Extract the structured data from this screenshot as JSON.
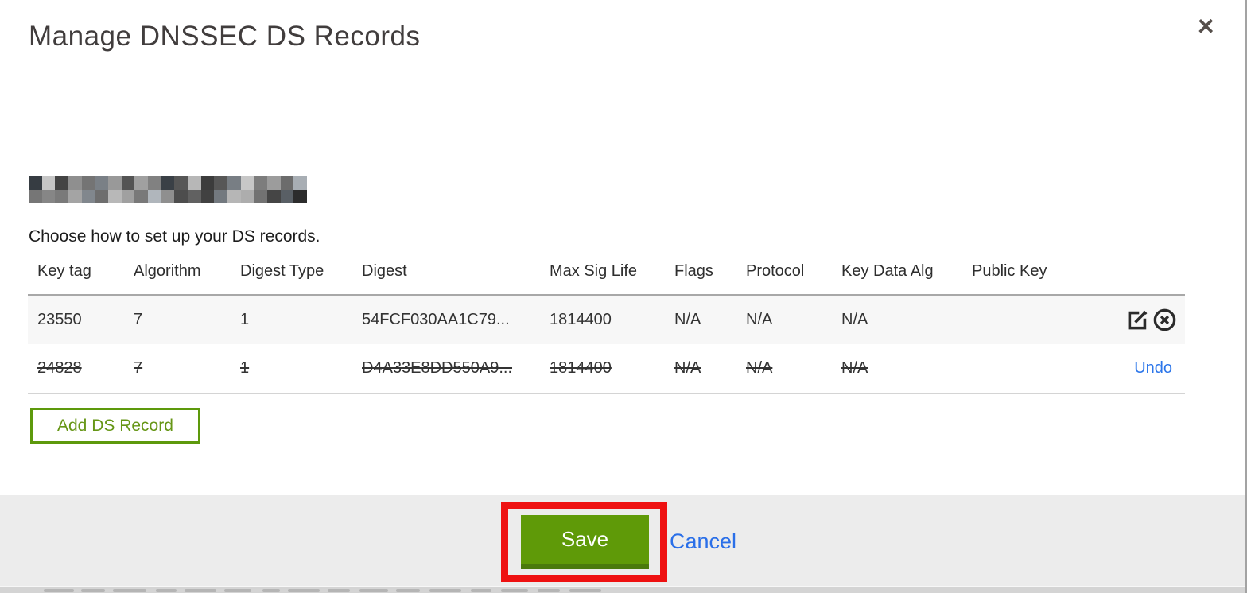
{
  "modal": {
    "title": "Manage DNSSEC DS Records",
    "close_glyph": "✕",
    "instruction": "Choose how to set up your DS records.",
    "add_button_label": "Add DS Record",
    "domain_redacted": true
  },
  "table": {
    "columns": [
      "Key tag",
      "Algorithm",
      "Digest Type",
      "Digest",
      "Max Sig Life",
      "Flags",
      "Protocol",
      "Key Data Alg",
      "Public Key"
    ],
    "rows": [
      {
        "key_tag": "23550",
        "algorithm": "7",
        "digest_type": "1",
        "digest": "54FCF030AA1C79...",
        "max_sig_life": "1814400",
        "flags": "N/A",
        "protocol": "N/A",
        "key_data_alg": "N/A",
        "public_key": "",
        "state": "normal",
        "actions": [
          "edit",
          "delete"
        ]
      },
      {
        "key_tag": "24828",
        "algorithm": "7",
        "digest_type": "1",
        "digest": "D4A33E8DD550A9...",
        "max_sig_life": "1814400",
        "flags": "N/A",
        "protocol": "N/A",
        "key_data_alg": "N/A",
        "public_key": "",
        "state": "deleted",
        "action_label": "Undo"
      }
    ]
  },
  "footer": {
    "save_label": "Save",
    "cancel_label": "Cancel"
  },
  "colors": {
    "accent_green": "#5f9a08",
    "button_border_green": "#5d990c",
    "link_blue": "#2a6fe8",
    "annotation_red": "#ee1111",
    "footer_gray": "#ececec"
  }
}
